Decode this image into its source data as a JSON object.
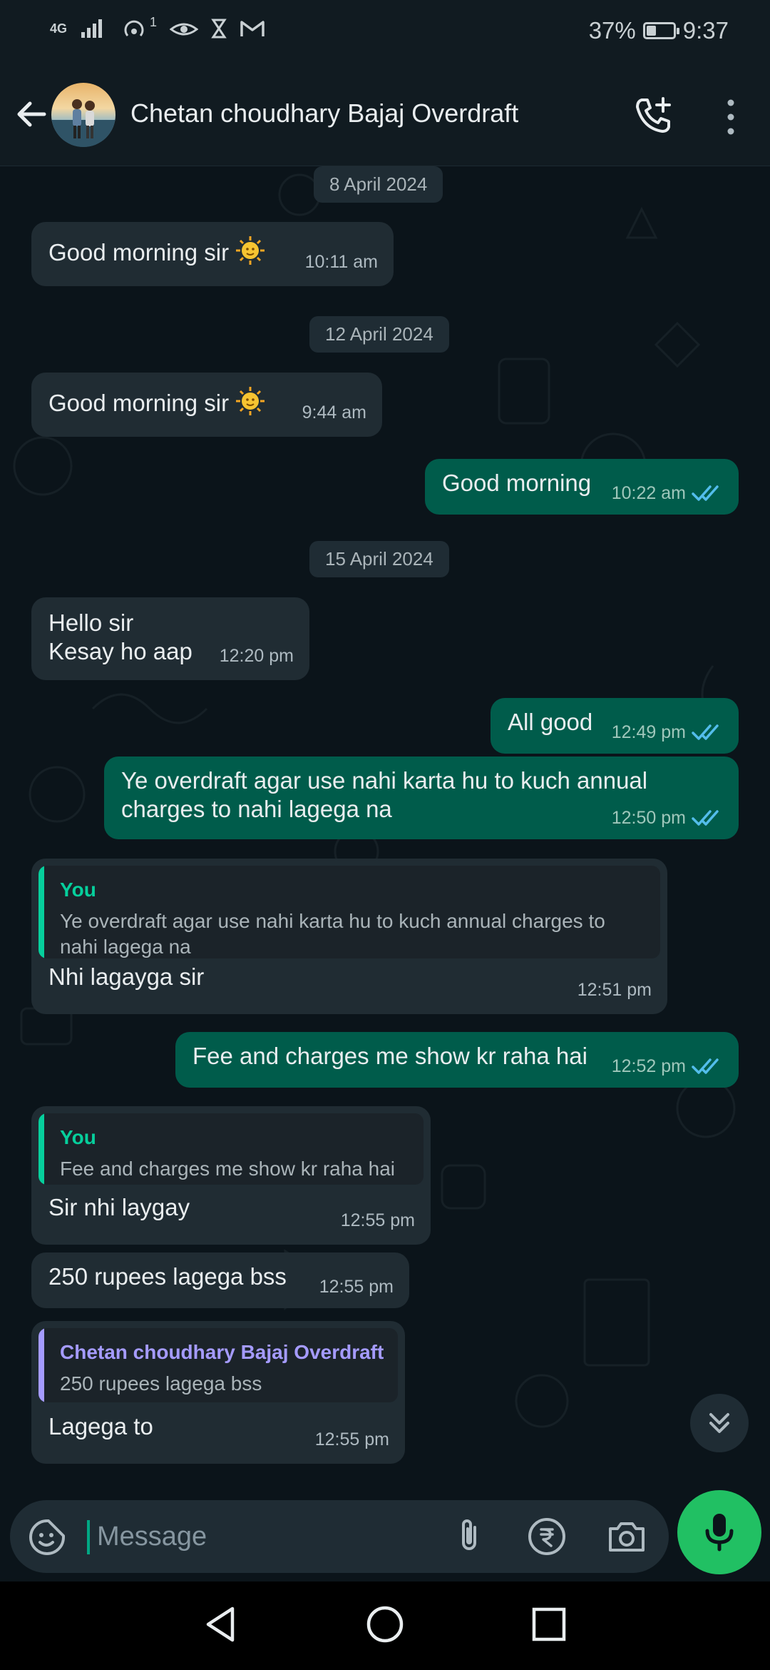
{
  "status_bar": {
    "network_label": "4G",
    "notification_count": "1",
    "battery_percent_text": "37%",
    "battery_level": 0.37,
    "time": "9:37"
  },
  "header": {
    "contact_name": "Chetan choudhary Bajaj Overdraft",
    "icons": [
      "back-arrow-icon",
      "avatar",
      "add-call-icon",
      "more-vert-icon"
    ]
  },
  "messages": [
    {
      "type": "date",
      "text": "8 April 2024"
    },
    {
      "type": "in",
      "text": "Good morning sir",
      "emoji": "sun-face",
      "time": "10:11 am"
    },
    {
      "type": "date",
      "text": "12 April 2024"
    },
    {
      "type": "in",
      "text": "Good morning sir",
      "emoji": "sun-face",
      "time": "9:44 am"
    },
    {
      "type": "out",
      "text": "Good morning",
      "time": "10:22 am",
      "status": "read"
    },
    {
      "type": "date",
      "text": "15 April 2024"
    },
    {
      "type": "in",
      "lines": [
        "Hello sir",
        "Kesay ho aap"
      ],
      "time": "12:20 pm"
    },
    {
      "type": "out",
      "text": "All good",
      "time": "12:49 pm",
      "status": "read"
    },
    {
      "type": "out",
      "lines": [
        "Ye overdraft agar use nahi karta hu to kuch annual",
        "charges to nahi lagega na"
      ],
      "time": "12:50 pm",
      "status": "read"
    },
    {
      "type": "in",
      "quote": {
        "name": "You",
        "lines": [
          "Ye overdraft agar use nahi karta hu to kuch annual charges to",
          "nahi lagega na"
        ]
      },
      "text": "Nhi lagayga sir",
      "time": "12:51 pm"
    },
    {
      "type": "out",
      "text": "Fee and charges me show kr raha hai",
      "time": "12:52 pm",
      "status": "read"
    },
    {
      "type": "in",
      "quote": {
        "name": "You",
        "lines": [
          "Fee and charges me show kr raha hai"
        ]
      },
      "text": "Sir nhi laygay",
      "time": "12:55 pm"
    },
    {
      "type": "in",
      "text": "250 rupees lagega bss",
      "time": "12:55 pm"
    },
    {
      "type": "in",
      "quote": {
        "name": "Chetan choudhary Bajaj Overdraft",
        "lines": [
          "250 rupees lagega bss"
        ]
      },
      "text": "Lagega to",
      "time": "12:55 pm"
    }
  ],
  "composer": {
    "placeholder": "Message",
    "icons": [
      "sticker-icon",
      "attach-icon",
      "rupee-payment-icon",
      "camera-icon",
      "mic-icon"
    ]
  },
  "colors": {
    "background": "#0b141a",
    "header": "#111b21",
    "incoming_bubble": "#202c33",
    "outgoing_bubble": "#005c4b",
    "quote_you": "#06cf9c",
    "quote_contact": "#a59bff",
    "read_ticks": "#53bdeb",
    "mic_button": "#21c063"
  }
}
